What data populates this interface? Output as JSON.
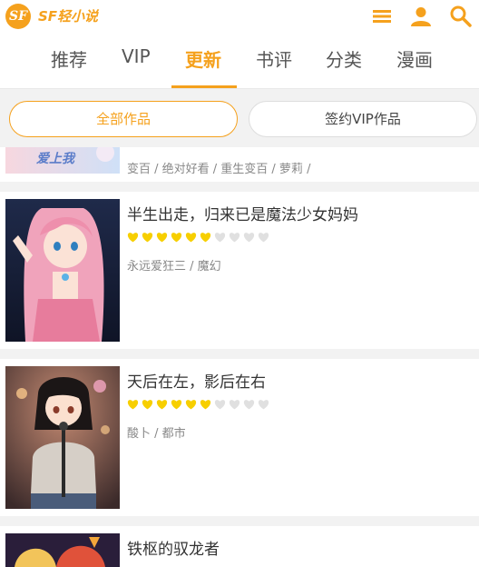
{
  "app": {
    "logo": "SF",
    "brand": "SF轻小说"
  },
  "header": {
    "icons": [
      "list-icon",
      "user-icon",
      "search-icon"
    ]
  },
  "nav": {
    "tabs": [
      {
        "label": "推荐",
        "active": false
      },
      {
        "label": "VIP",
        "active": false
      },
      {
        "label": "更新",
        "active": true
      },
      {
        "label": "书评",
        "active": false
      },
      {
        "label": "分类",
        "active": false
      },
      {
        "label": "漫画",
        "active": false
      }
    ]
  },
  "filters": {
    "all_label": "全部作品",
    "vip_label": "签约VIP作品"
  },
  "books": [
    {
      "title": "",
      "rating": null,
      "meta": "变百 / 绝对好看 / 重生变百 / 萝莉 /",
      "cover_text": "爱上我"
    },
    {
      "title": "半生出走，归来已是魔法少女妈妈",
      "rating": 6,
      "rating_max": 10,
      "meta": "永远爱狂三 / 魔幻"
    },
    {
      "title": "天后在左，影后在右",
      "rating": 6,
      "rating_max": 10,
      "meta": "酸卜 / 都市"
    },
    {
      "title": "铁枢的驭龙者",
      "rating": null,
      "meta": ""
    }
  ],
  "colors": {
    "accent": "#f5a11d",
    "heart_on": "#f7cf00",
    "heart_off": "#e0e0e0"
  }
}
